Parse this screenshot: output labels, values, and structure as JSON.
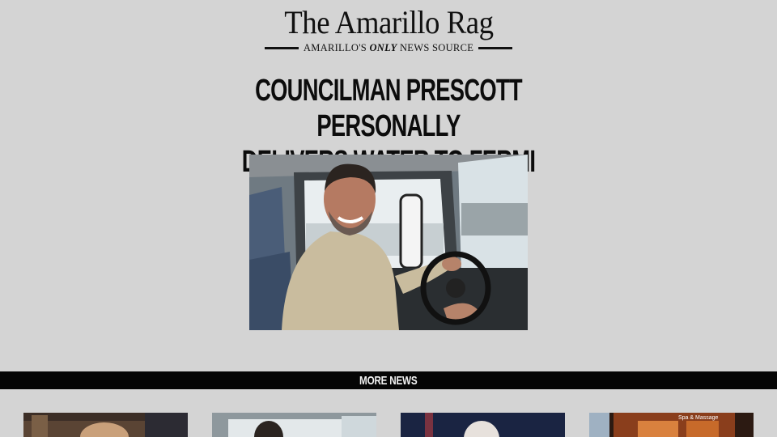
{
  "masthead": {
    "title": "The Amarillo Rag",
    "tagline_prefix": "AMARILLO'S",
    "tagline_emphasis": "ONLY",
    "tagline_suffix": "NEWS SOURCE"
  },
  "headline": {
    "line1": "COUNCILMAN PRESCOTT PERSONALLY",
    "line2": "DELIVERS WATER TO FERMI"
  },
  "hero_image": {
    "icon": "photo-man-driving-truck"
  },
  "more_news": {
    "label": "MORE NEWS",
    "thumbnails": [
      {
        "icon": "photo-man-bookshelf"
      },
      {
        "icon": "photo-man-truck-cab"
      },
      {
        "icon": "photo-older-man"
      },
      {
        "icon": "photo-spa-storefront",
        "sign_text": "Spa & Massage"
      }
    ]
  },
  "colors": {
    "background": "#d4d4d4",
    "ink": "#111111",
    "bar": "#050505"
  }
}
